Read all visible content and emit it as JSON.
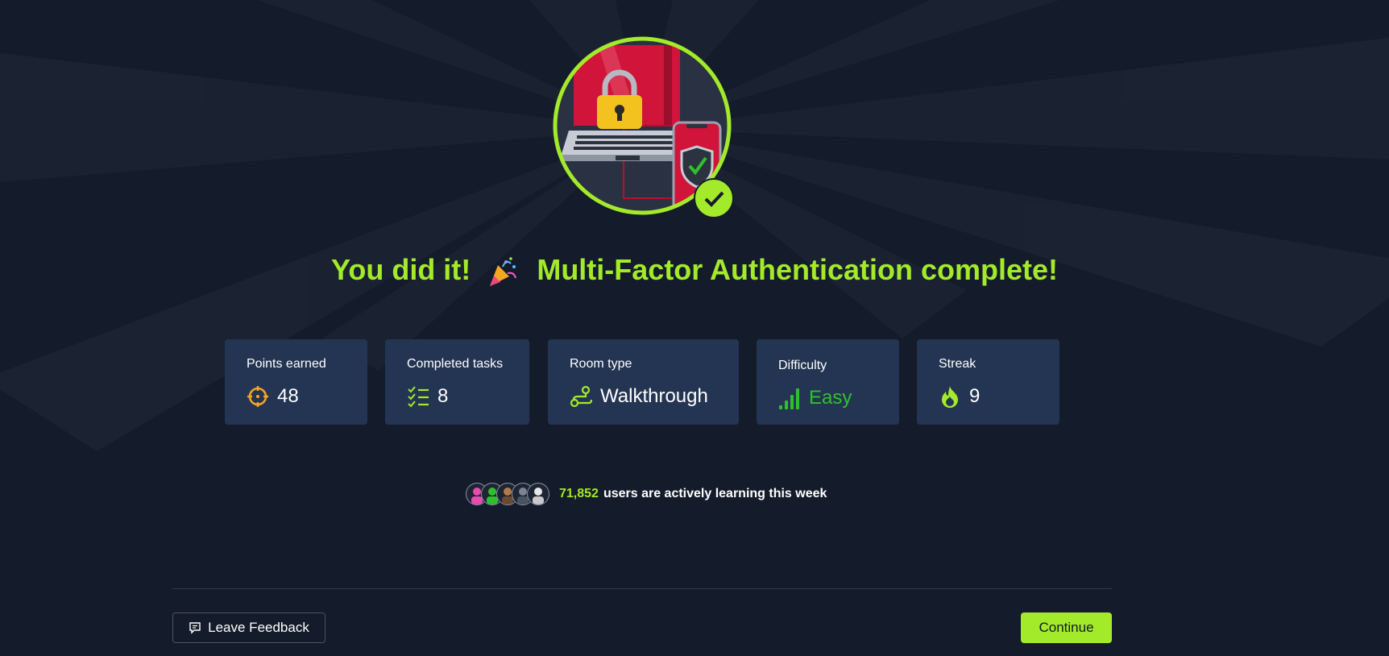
{
  "headline": {
    "text_before": "You did it!",
    "emoji": "party-popper-icon",
    "text_after": "Multi-Factor Authentication complete!"
  },
  "badge": {
    "image": "laptop-lock-phone-shield-illustration",
    "complete_icon": "checkmark-icon"
  },
  "stats": [
    {
      "label": "Points earned",
      "value": "48",
      "icon": "crosshair-target-icon"
    },
    {
      "label": "Completed tasks",
      "value": "8",
      "icon": "checklist-icon"
    },
    {
      "label": "Room type",
      "value": "Walkthrough",
      "icon": "route-path-icon"
    },
    {
      "label": "Difficulty",
      "value": "Easy",
      "icon": "signal-bars-icon"
    },
    {
      "label": "Streak",
      "value": "9",
      "icon": "flame-icon"
    }
  ],
  "learners": {
    "count": "71,852",
    "text": "users are actively learning this week"
  },
  "footer": {
    "feedback_label": "Leave Feedback",
    "continue_label": "Continue"
  },
  "colors": {
    "background": "#141b2a",
    "accent_green": "#a3ea2a",
    "card_bg": "#233552",
    "difficulty_green": "#2ec12e",
    "points_orange": "#f5a623"
  }
}
